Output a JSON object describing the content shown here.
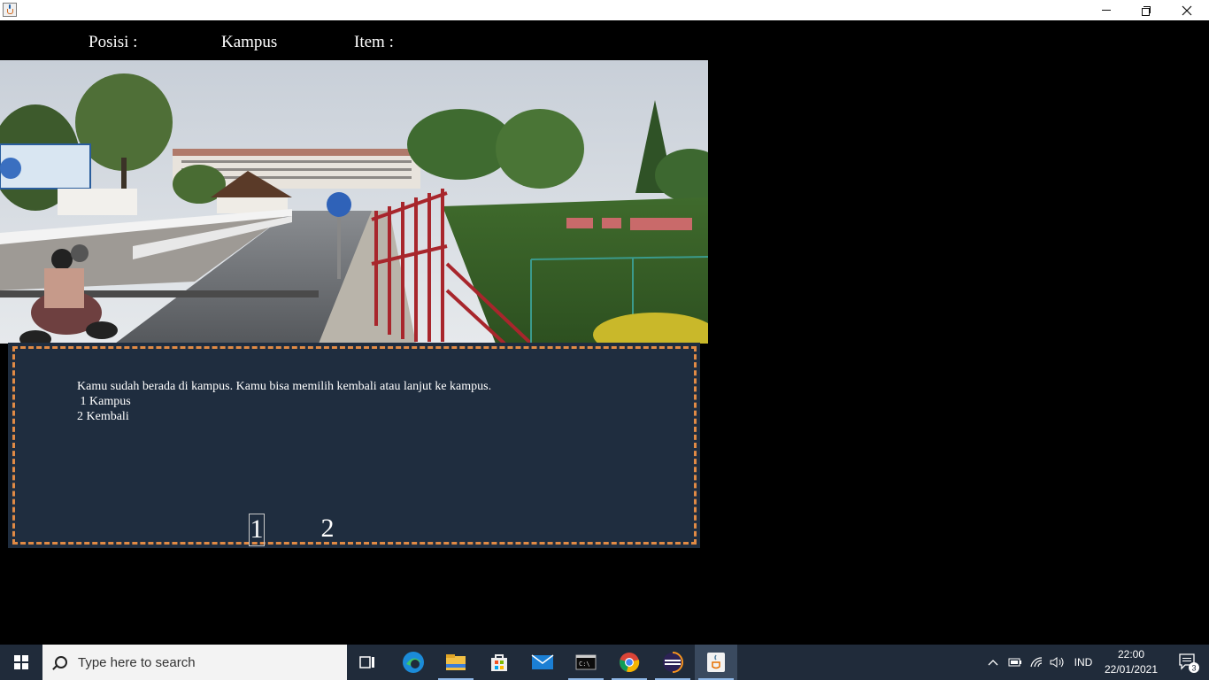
{
  "window": {
    "icon": "java-icon",
    "controls": {
      "minimize": "minimize-icon",
      "maximize": "restore-icon",
      "close": "close-icon"
    }
  },
  "status": {
    "position_label": "Posisi :",
    "position_value": "Kampus",
    "item_label": "Item :"
  },
  "story": {
    "text": "Kamu sudah berada di kampus. Kamu bisa memilih kembali atau lanjut ke kampus.\n 1 Kampus\n2 Kembali"
  },
  "choices": [
    {
      "label": "1"
    },
    {
      "label": "2"
    }
  ],
  "taskbar": {
    "search_placeholder": "Type here to search",
    "pinned": [
      "task-view-icon",
      "edge-icon",
      "file-explorer-icon",
      "store-icon",
      "mail-icon",
      "terminal-icon",
      "chrome-icon",
      "eclipse-icon",
      "java-icon"
    ],
    "language": "IND",
    "time": "22:00",
    "date": "22/01/2021",
    "notification_count": "3"
  },
  "colors": {
    "panel_bg": "#1f2d3f",
    "panel_border": "#e08a45",
    "taskbar_bg": "#202b3a"
  }
}
